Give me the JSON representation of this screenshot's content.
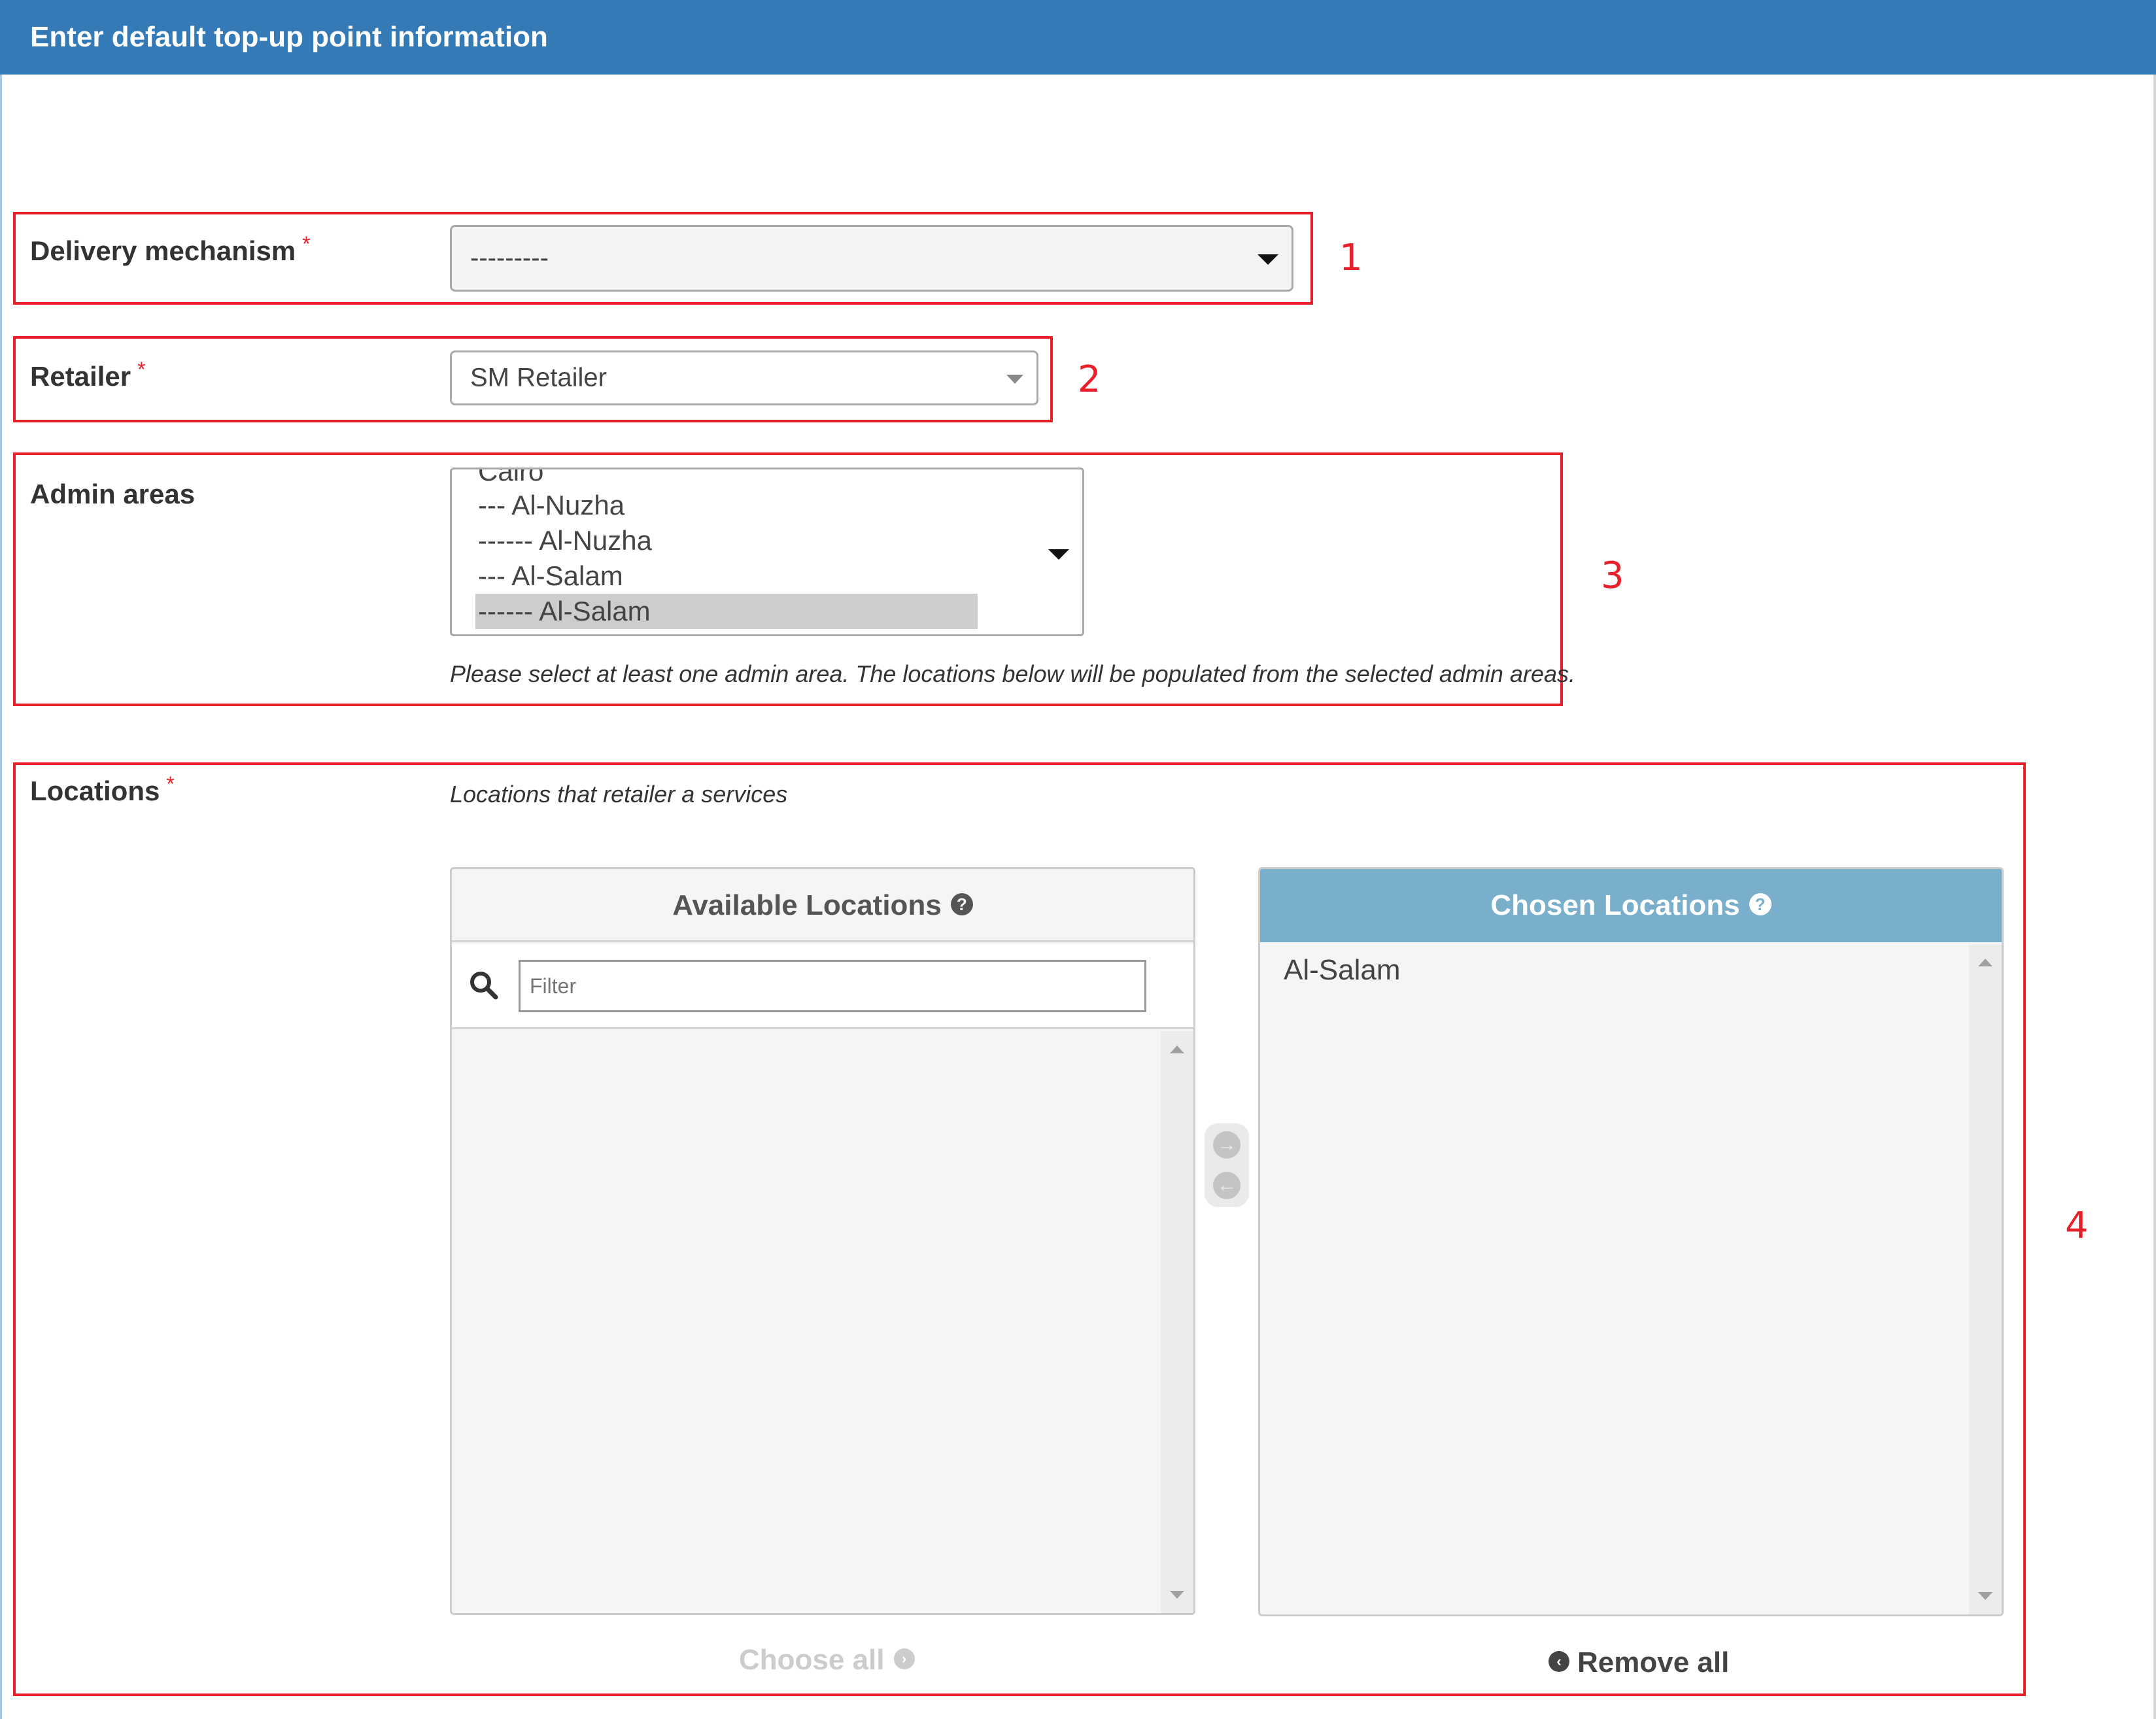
{
  "header": {
    "title": "Enter default top-up point information"
  },
  "form": {
    "delivery_mechanism": {
      "label": "Delivery mechanism",
      "required_mark": "*",
      "value": "---------"
    },
    "retailer": {
      "label": "Retailer",
      "required_mark": "*",
      "value": "SM Retailer"
    },
    "admin_areas": {
      "label": "Admin areas",
      "options": [
        "Cairo",
        "--- Al-Nuzha",
        "------ Al-Nuzha",
        "--- Al-Salam",
        "------ Al-Salam"
      ],
      "selected": "------ Al-Salam",
      "help": "Please select at least one admin area. The locations below will be populated from the selected admin areas."
    },
    "locations": {
      "label": "Locations",
      "required_mark": "*",
      "help": "Locations that retailer a services",
      "available": {
        "title": "Available Locations",
        "help_icon": "?",
        "filter_placeholder": "Filter",
        "items": []
      },
      "chosen": {
        "title": "Chosen Locations",
        "help_icon": "?",
        "items": [
          "Al-Salam"
        ]
      },
      "choose_all_label": "Choose all",
      "remove_all_label": "Remove all"
    }
  },
  "annotations": {
    "n1": "1",
    "n2": "2",
    "n3": "3",
    "n4": "4"
  },
  "colors": {
    "header": "#337ab7",
    "annotation": "#e8202a",
    "chosen_header": "#7aafcb"
  },
  "icons": {
    "search": "search-icon",
    "help": "question-circle-icon",
    "move_right": "arrow-circle-right-icon",
    "move_left": "arrow-circle-left-icon",
    "choose_all": "chevron-circle-right-icon",
    "remove_all": "chevron-circle-left-icon"
  }
}
